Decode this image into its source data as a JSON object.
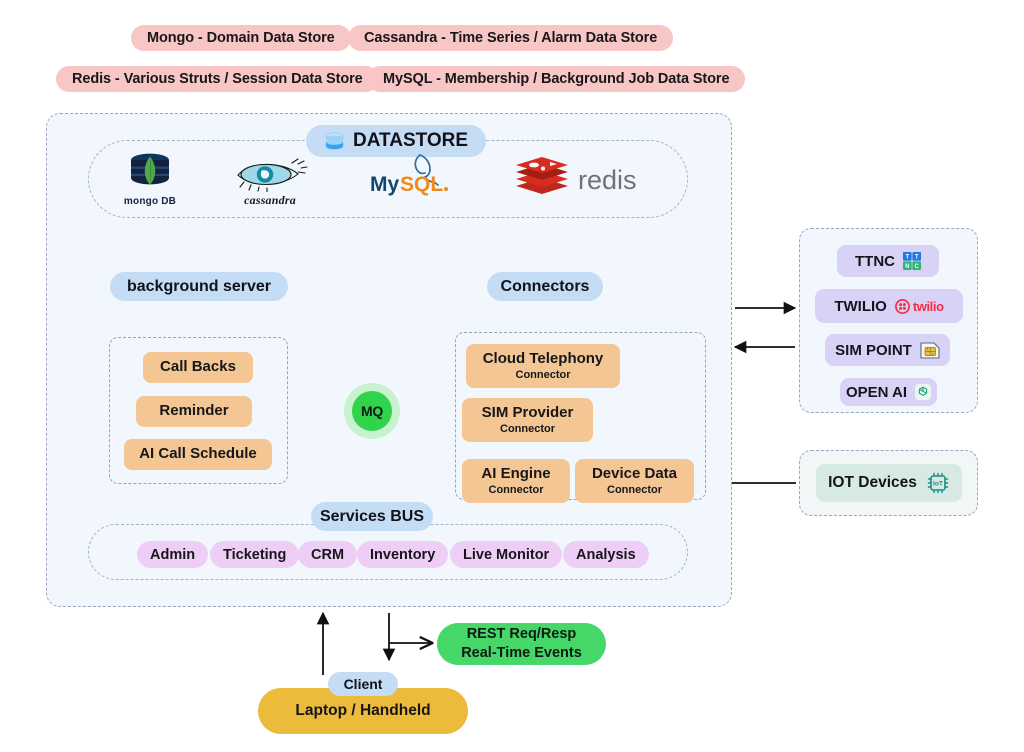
{
  "legend": {
    "items": [
      {
        "label": "Mongo - Domain Data Store"
      },
      {
        "label": "Cassandra - Time Series / Alarm Data Store"
      },
      {
        "label": "Redis - Various Struts / Session Data Store"
      },
      {
        "label": "MySQL - Membership / Background Job Data Store"
      }
    ]
  },
  "datastore": {
    "title": "DATASTORE",
    "icon": "database-cylinder-icon",
    "logos": [
      {
        "name": "mongodb-logo",
        "caption": "mongo DB"
      },
      {
        "name": "cassandra-logo",
        "caption": "cassandra"
      },
      {
        "name": "mysql-logo",
        "caption_a": "My",
        "caption_b": "SQL"
      },
      {
        "name": "redis-logo",
        "caption": "redis"
      }
    ]
  },
  "background_server": {
    "label": "background server",
    "cards": [
      {
        "title": "Call Backs"
      },
      {
        "title": "Reminder"
      },
      {
        "title": "AI Call Schedule"
      }
    ]
  },
  "connectors": {
    "label": "Connectors",
    "cards": [
      {
        "title": "Cloud Telephony",
        "subtitle": "Connector"
      },
      {
        "title": "SIM Provider",
        "subtitle": "Connector"
      },
      {
        "title": "AI Engine",
        "subtitle": "Connector"
      },
      {
        "title": "Device Data",
        "subtitle": "Connector"
      }
    ]
  },
  "mq": {
    "label": "MQ"
  },
  "services_bus": {
    "label": "Services BUS",
    "services": [
      {
        "label": "Admin"
      },
      {
        "label": "Ticketing"
      },
      {
        "label": "CRM"
      },
      {
        "label": "Inventory"
      },
      {
        "label": "Live Monitor"
      },
      {
        "label": "Analysis"
      }
    ]
  },
  "providers": {
    "items": [
      {
        "label": "TTNC",
        "icon": "ttnc-logo"
      },
      {
        "label": "TWILIO",
        "icon": "twilio-logo"
      },
      {
        "label": "SIM POINT",
        "icon": "sim-card-icon"
      },
      {
        "label": "OPEN AI",
        "icon": "openai-logo"
      }
    ]
  },
  "iot": {
    "items": [
      {
        "label": "IOT Devices",
        "icon": "iot-chip-icon"
      }
    ]
  },
  "bottom": {
    "client_badge": "Client",
    "client_device": "Laptop / Handheld",
    "rest_line1": "REST Req/Resp",
    "rest_line2": "Real-Time Events"
  },
  "colors": {
    "legend_pink": "#f9c6c6",
    "badge_blue": "#c5dcf5",
    "card_orange": "#f4c693",
    "pill_purple": "#eecdf6",
    "card_violet": "#d9d2f7",
    "card_mint": "#d6e9e2",
    "mq_green": "#2fd44a",
    "rest_green": "#45d768",
    "client_gold": "#ecbb3b",
    "panel_bg": "#f2f7fd"
  }
}
